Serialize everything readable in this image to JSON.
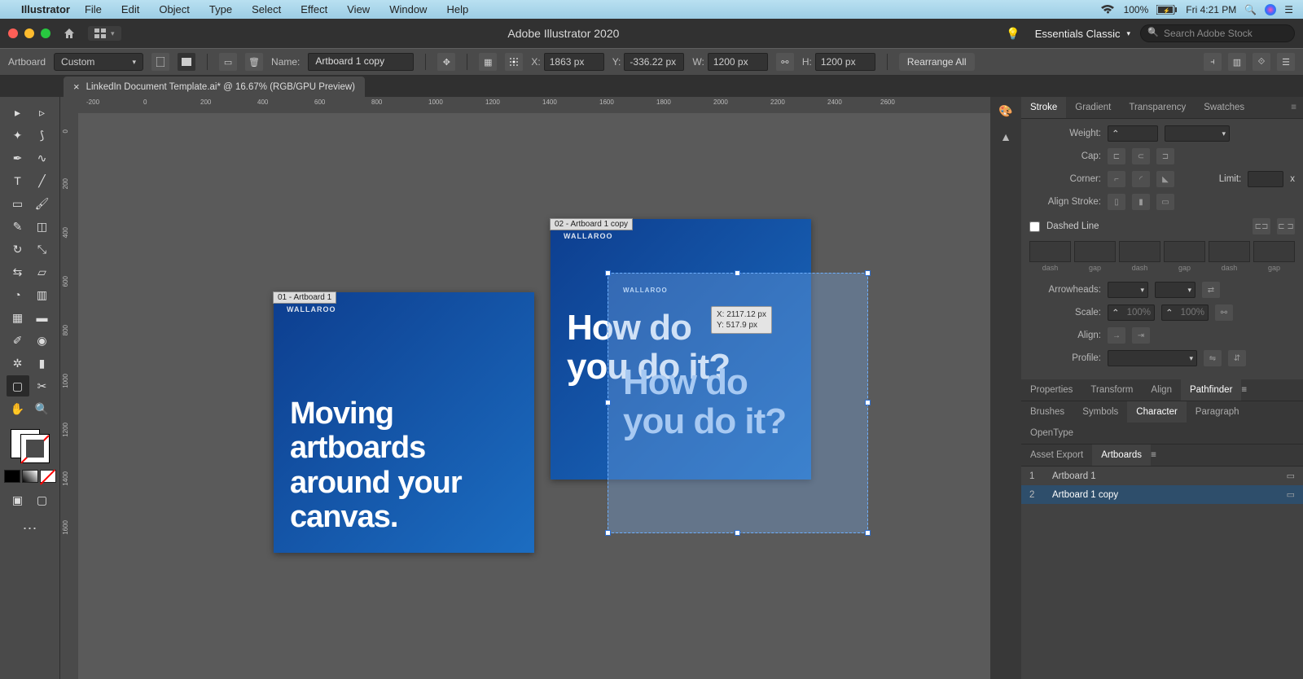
{
  "menubar": {
    "app": "Illustrator",
    "items": [
      "File",
      "Edit",
      "Object",
      "Type",
      "Select",
      "Effect",
      "View",
      "Window",
      "Help"
    ],
    "battery": "100%",
    "clock": "Fri 4:21 PM"
  },
  "titlebar": {
    "title": "Adobe Illustrator 2020",
    "workspace": "Essentials Classic",
    "search_placeholder": "Search Adobe Stock"
  },
  "controlbar": {
    "tool_label": "Artboard",
    "preset": "Custom",
    "name_label": "Name:",
    "name_value": "Artboard 1 copy",
    "x_label": "X:",
    "x_value": "1863 px",
    "y_label": "Y:",
    "y_value": "-336.22 px",
    "w_label": "W:",
    "w_value": "1200 px",
    "h_label": "H:",
    "h_value": "1200 px",
    "rearrange": "Rearrange All"
  },
  "document_tab": "LinkedIn Document Template.ai* @ 16.67% (RGB/GPU Preview)",
  "ruler_h": [
    "-200",
    "0",
    "200",
    "400",
    "600",
    "800",
    "1000",
    "1200",
    "1400",
    "1600",
    "1800",
    "2000",
    "2200",
    "2400",
    "2600"
  ],
  "ruler_v": [
    "0",
    "200",
    "400",
    "600",
    "800",
    "1000",
    "1200",
    "1400",
    "1600"
  ],
  "artboard1": {
    "label": "01 - Artboard 1",
    "brand": "WALLAROO",
    "text": "Moving\nartboards\naround your\ncanvas."
  },
  "artboard2": {
    "label": "02 - Artboard 1 copy",
    "brand": "WALLAROO",
    "text": "How do\nyou do it?"
  },
  "ghost": {
    "brand": "WALLAROO",
    "text": "How do\nyou do it?",
    "tip_x": "X: 2117.12 px",
    "tip_y": "Y: 517.9 px"
  },
  "panels": {
    "stroke": {
      "tabs": [
        "Stroke",
        "Gradient",
        "Transparency",
        "Swatches"
      ],
      "weight_label": "Weight:",
      "cap_label": "Cap:",
      "corner_label": "Corner:",
      "limit_label": "Limit:",
      "limit_x": "x",
      "align_stroke_label": "Align Stroke:",
      "dashed_label": "Dashed Line",
      "dash_labels": [
        "dash",
        "gap",
        "dash",
        "gap",
        "dash",
        "gap"
      ],
      "arrow_label": "Arrowheads:",
      "scale_label": "Scale:",
      "scale_val": "100%",
      "align_label": "Align:",
      "profile_label": "Profile:"
    },
    "tabs2_row1": [
      "Properties",
      "Transform",
      "Align",
      "Pathfinder"
    ],
    "tabs2_row2": [
      "Brushes",
      "Symbols",
      "Character",
      "Paragraph",
      "OpenType"
    ],
    "tabs3": [
      "Asset Export",
      "Artboards"
    ],
    "artboards": [
      {
        "num": "1",
        "name": "Artboard 1"
      },
      {
        "num": "2",
        "name": "Artboard 1 copy"
      }
    ]
  }
}
